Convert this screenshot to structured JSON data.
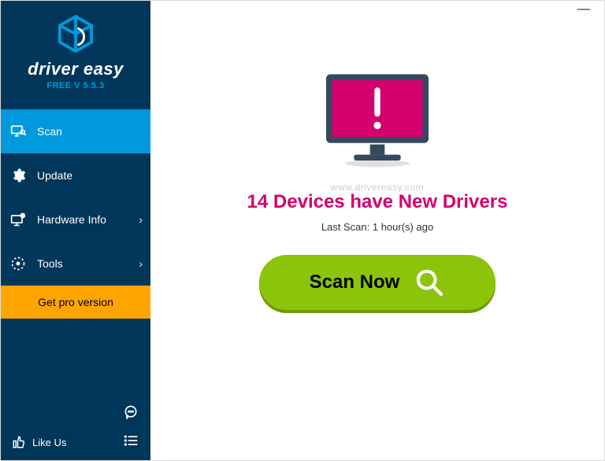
{
  "brand": {
    "name": "driver easy",
    "version_line": "FREE V 5.5.3"
  },
  "sidebar": {
    "items": [
      {
        "label": "Scan"
      },
      {
        "label": "Update"
      },
      {
        "label": "Hardware Info"
      },
      {
        "label": "Tools"
      }
    ],
    "pro_label": "Get pro version",
    "likeus_label": "Like Us"
  },
  "main": {
    "watermark": "www.drivereasy.com",
    "headline": "14 Devices have New Drivers",
    "last_scan": "Last Scan: 1 hour(s) ago",
    "scan_button": "Scan Now"
  }
}
